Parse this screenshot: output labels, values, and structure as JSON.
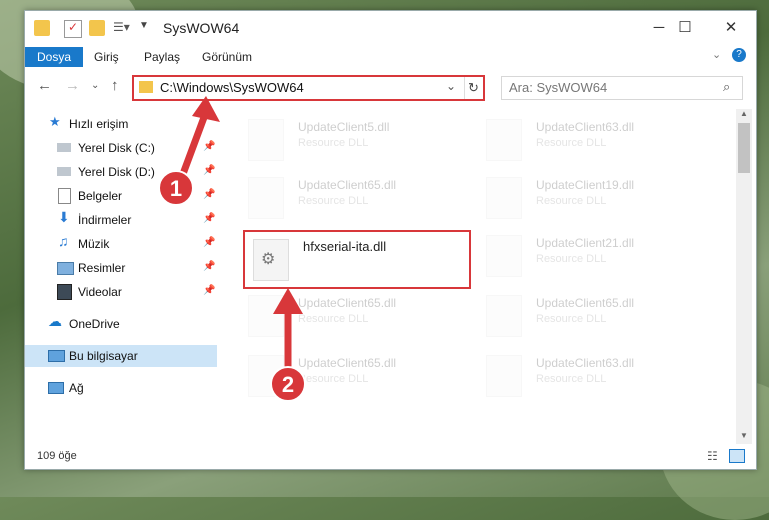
{
  "window": {
    "title": "SysWOW64"
  },
  "ribbon": {
    "tabs": [
      "Dosya",
      "Giriş",
      "Paylaş",
      "Görünüm"
    ]
  },
  "address": {
    "path": "C:\\Windows\\SysWOW64"
  },
  "search": {
    "placeholder": "Ara: SysWOW64"
  },
  "sidebar": {
    "items": [
      {
        "label": "Hızlı erişim"
      },
      {
        "label": "Yerel Disk (C:)"
      },
      {
        "label": "Yerel Disk (D:)"
      },
      {
        "label": "Belgeler"
      },
      {
        "label": "İndirmeler"
      },
      {
        "label": "Müzik"
      },
      {
        "label": "Resimler"
      },
      {
        "label": "Videolar"
      },
      {
        "label": "OneDrive"
      },
      {
        "label": "Bu bilgisayar"
      },
      {
        "label": "Ağ"
      }
    ]
  },
  "files": [
    {
      "name": "UpdateClient5.dll",
      "type": "Resource DLL"
    },
    {
      "name": "UpdateClient63.dll",
      "type": "Resource DLL"
    },
    {
      "name": "UpdateClient65.dll",
      "type": "Resource DLL"
    },
    {
      "name": "UpdateClient19.dll",
      "type": "Resource DLL"
    },
    {
      "name": "hfxserial-ita.dll",
      "type": ""
    },
    {
      "name": "UpdateClient21.dll",
      "type": "Resource DLL"
    },
    {
      "name": "UpdateClient65.dll",
      "type": "Resource DLL"
    },
    {
      "name": "UpdateClient65.dll",
      "type": "Resource DLL"
    },
    {
      "name": "UpdateClient65.dll",
      "type": "Resource DLL"
    },
    {
      "name": "UpdateClient63.dll",
      "type": "Resource DLL"
    }
  ],
  "status": {
    "count": "109 öğe"
  },
  "annotations": {
    "step1": "1",
    "step2": "2"
  },
  "colors": {
    "accent": "#1979ca",
    "highlight": "#d8373a"
  }
}
